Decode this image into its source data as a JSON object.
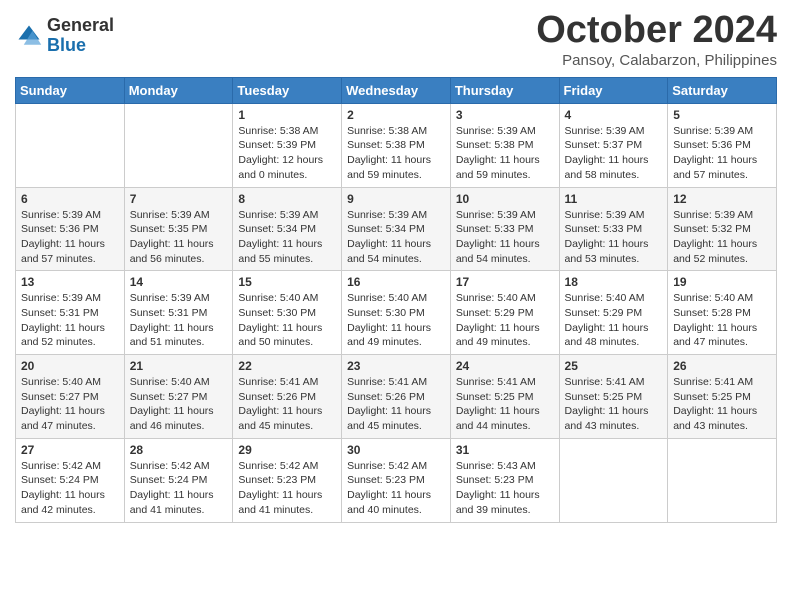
{
  "header": {
    "logo": {
      "general": "General",
      "blue": "Blue"
    },
    "title": "October 2024",
    "subtitle": "Pansoy, Calabarzon, Philippines"
  },
  "days_of_week": [
    "Sunday",
    "Monday",
    "Tuesday",
    "Wednesday",
    "Thursday",
    "Friday",
    "Saturday"
  ],
  "weeks": [
    [
      {
        "day": "",
        "info": ""
      },
      {
        "day": "",
        "info": ""
      },
      {
        "day": "1",
        "info": "Sunrise: 5:38 AM\nSunset: 5:39 PM\nDaylight: 12 hours and 0 minutes."
      },
      {
        "day": "2",
        "info": "Sunrise: 5:38 AM\nSunset: 5:38 PM\nDaylight: 11 hours and 59 minutes."
      },
      {
        "day": "3",
        "info": "Sunrise: 5:39 AM\nSunset: 5:38 PM\nDaylight: 11 hours and 59 minutes."
      },
      {
        "day": "4",
        "info": "Sunrise: 5:39 AM\nSunset: 5:37 PM\nDaylight: 11 hours and 58 minutes."
      },
      {
        "day": "5",
        "info": "Sunrise: 5:39 AM\nSunset: 5:36 PM\nDaylight: 11 hours and 57 minutes."
      }
    ],
    [
      {
        "day": "6",
        "info": "Sunrise: 5:39 AM\nSunset: 5:36 PM\nDaylight: 11 hours and 57 minutes."
      },
      {
        "day": "7",
        "info": "Sunrise: 5:39 AM\nSunset: 5:35 PM\nDaylight: 11 hours and 56 minutes."
      },
      {
        "day": "8",
        "info": "Sunrise: 5:39 AM\nSunset: 5:34 PM\nDaylight: 11 hours and 55 minutes."
      },
      {
        "day": "9",
        "info": "Sunrise: 5:39 AM\nSunset: 5:34 PM\nDaylight: 11 hours and 54 minutes."
      },
      {
        "day": "10",
        "info": "Sunrise: 5:39 AM\nSunset: 5:33 PM\nDaylight: 11 hours and 54 minutes."
      },
      {
        "day": "11",
        "info": "Sunrise: 5:39 AM\nSunset: 5:33 PM\nDaylight: 11 hours and 53 minutes."
      },
      {
        "day": "12",
        "info": "Sunrise: 5:39 AM\nSunset: 5:32 PM\nDaylight: 11 hours and 52 minutes."
      }
    ],
    [
      {
        "day": "13",
        "info": "Sunrise: 5:39 AM\nSunset: 5:31 PM\nDaylight: 11 hours and 52 minutes."
      },
      {
        "day": "14",
        "info": "Sunrise: 5:39 AM\nSunset: 5:31 PM\nDaylight: 11 hours and 51 minutes."
      },
      {
        "day": "15",
        "info": "Sunrise: 5:40 AM\nSunset: 5:30 PM\nDaylight: 11 hours and 50 minutes."
      },
      {
        "day": "16",
        "info": "Sunrise: 5:40 AM\nSunset: 5:30 PM\nDaylight: 11 hours and 49 minutes."
      },
      {
        "day": "17",
        "info": "Sunrise: 5:40 AM\nSunset: 5:29 PM\nDaylight: 11 hours and 49 minutes."
      },
      {
        "day": "18",
        "info": "Sunrise: 5:40 AM\nSunset: 5:29 PM\nDaylight: 11 hours and 48 minutes."
      },
      {
        "day": "19",
        "info": "Sunrise: 5:40 AM\nSunset: 5:28 PM\nDaylight: 11 hours and 47 minutes."
      }
    ],
    [
      {
        "day": "20",
        "info": "Sunrise: 5:40 AM\nSunset: 5:27 PM\nDaylight: 11 hours and 47 minutes."
      },
      {
        "day": "21",
        "info": "Sunrise: 5:40 AM\nSunset: 5:27 PM\nDaylight: 11 hours and 46 minutes."
      },
      {
        "day": "22",
        "info": "Sunrise: 5:41 AM\nSunset: 5:26 PM\nDaylight: 11 hours and 45 minutes."
      },
      {
        "day": "23",
        "info": "Sunrise: 5:41 AM\nSunset: 5:26 PM\nDaylight: 11 hours and 45 minutes."
      },
      {
        "day": "24",
        "info": "Sunrise: 5:41 AM\nSunset: 5:25 PM\nDaylight: 11 hours and 44 minutes."
      },
      {
        "day": "25",
        "info": "Sunrise: 5:41 AM\nSunset: 5:25 PM\nDaylight: 11 hours and 43 minutes."
      },
      {
        "day": "26",
        "info": "Sunrise: 5:41 AM\nSunset: 5:25 PM\nDaylight: 11 hours and 43 minutes."
      }
    ],
    [
      {
        "day": "27",
        "info": "Sunrise: 5:42 AM\nSunset: 5:24 PM\nDaylight: 11 hours and 42 minutes."
      },
      {
        "day": "28",
        "info": "Sunrise: 5:42 AM\nSunset: 5:24 PM\nDaylight: 11 hours and 41 minutes."
      },
      {
        "day": "29",
        "info": "Sunrise: 5:42 AM\nSunset: 5:23 PM\nDaylight: 11 hours and 41 minutes."
      },
      {
        "day": "30",
        "info": "Sunrise: 5:42 AM\nSunset: 5:23 PM\nDaylight: 11 hours and 40 minutes."
      },
      {
        "day": "31",
        "info": "Sunrise: 5:43 AM\nSunset: 5:23 PM\nDaylight: 11 hours and 39 minutes."
      },
      {
        "day": "",
        "info": ""
      },
      {
        "day": "",
        "info": ""
      }
    ]
  ]
}
